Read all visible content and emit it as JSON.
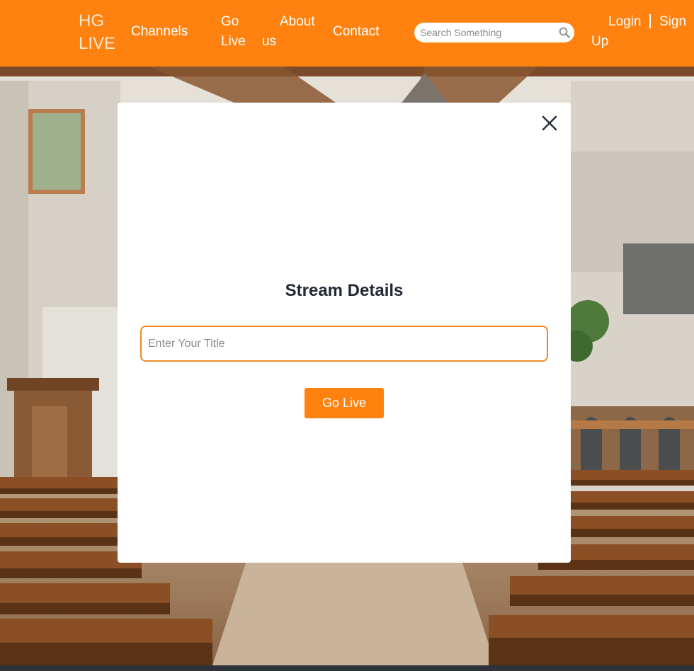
{
  "header": {
    "brand_line1": "HG",
    "brand_line2": "LIVE",
    "nav": {
      "channels": "Channels",
      "go_live_line1": "Go",
      "go_live_line2": "Live",
      "about_line1": "About",
      "about_line2": "us",
      "contact": "Contact"
    },
    "search": {
      "placeholder": "Search Something",
      "value": ""
    },
    "auth": {
      "login": "Login",
      "signup_line1": "Sign",
      "signup_line2": "Up"
    }
  },
  "modal": {
    "title": "Stream Details",
    "input": {
      "placeholder": "Enter Your Title",
      "value": ""
    },
    "submit_label": "Go Live",
    "close_icon": "close-icon"
  },
  "icons": {
    "search": "search-icon",
    "close": "close-icon"
  },
  "colors": {
    "brand_orange": "#ff8210",
    "input_border": "#f08a24",
    "title_text": "#222a36"
  }
}
